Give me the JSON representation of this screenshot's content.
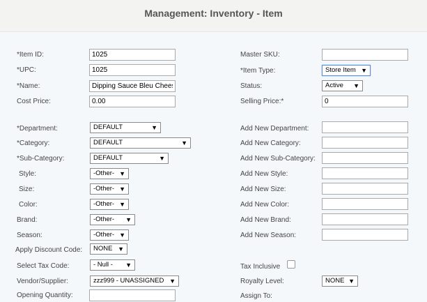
{
  "page": {
    "title": "Management: Inventory - Item"
  },
  "left": {
    "item_id": {
      "label": "*Item ID:",
      "value": "1025"
    },
    "upc": {
      "label": "*UPC:",
      "value": "1025"
    },
    "name": {
      "label": "*Name:",
      "value": "Dipping Sauce Bleu Cheese"
    },
    "cost_price": {
      "label": "Cost Price:",
      "value": "0.00"
    },
    "department": {
      "label": "*Department:",
      "value": "DEFAULT"
    },
    "category": {
      "label": "*Category:",
      "value": "DEFAULT"
    },
    "sub_category": {
      "label": "*Sub-Category:",
      "value": "DEFAULT"
    },
    "style": {
      "label": "Style:",
      "value": "-Other-"
    },
    "size": {
      "label": "Size:",
      "value": "-Other-"
    },
    "color": {
      "label": "Color:",
      "value": "-Other-"
    },
    "brand": {
      "label": "Brand:",
      "value": "-Other-"
    },
    "season": {
      "label": "Season:",
      "value": "-Other-"
    },
    "discount": {
      "label": "Apply Discount Code:",
      "value": "NONE"
    },
    "tax_code": {
      "label": "Select Tax Code:",
      "value": "- Null -"
    },
    "vendor": {
      "label": "Vendor/Supplier:",
      "value": "zzz999 - UNASSIGNED"
    },
    "opening_qty": {
      "label": "Opening Quantity:",
      "value": ""
    }
  },
  "right": {
    "master_sku": {
      "label": "Master SKU:",
      "value": ""
    },
    "item_type": {
      "label": "*Item Type:",
      "value": "Store Item"
    },
    "status": {
      "label": "Status:",
      "value": "Active"
    },
    "selling_price": {
      "label": "Selling Price:*",
      "value": "0"
    },
    "new_department": {
      "label": "Add New Department:",
      "value": ""
    },
    "new_category": {
      "label": "Add New Category:",
      "value": ""
    },
    "new_sub_category": {
      "label": "Add New Sub-Category:",
      "value": ""
    },
    "new_style": {
      "label": "Add New Style:",
      "value": ""
    },
    "new_size": {
      "label": "Add New Size:",
      "value": ""
    },
    "new_color": {
      "label": "Add New Color:",
      "value": ""
    },
    "new_brand": {
      "label": "Add New Brand:",
      "value": ""
    },
    "new_season": {
      "label": "Add New Season:",
      "value": ""
    },
    "tax_inclusive": {
      "label": "Tax Inclusive",
      "checked": false
    },
    "royalty_level": {
      "label": "Royalty Level:",
      "value": "NONE"
    },
    "assign_to": {
      "label": "Assign To:"
    }
  },
  "icons": {
    "dropdown": "chevron-down-icon",
    "checkbox": "checkbox-icon"
  }
}
